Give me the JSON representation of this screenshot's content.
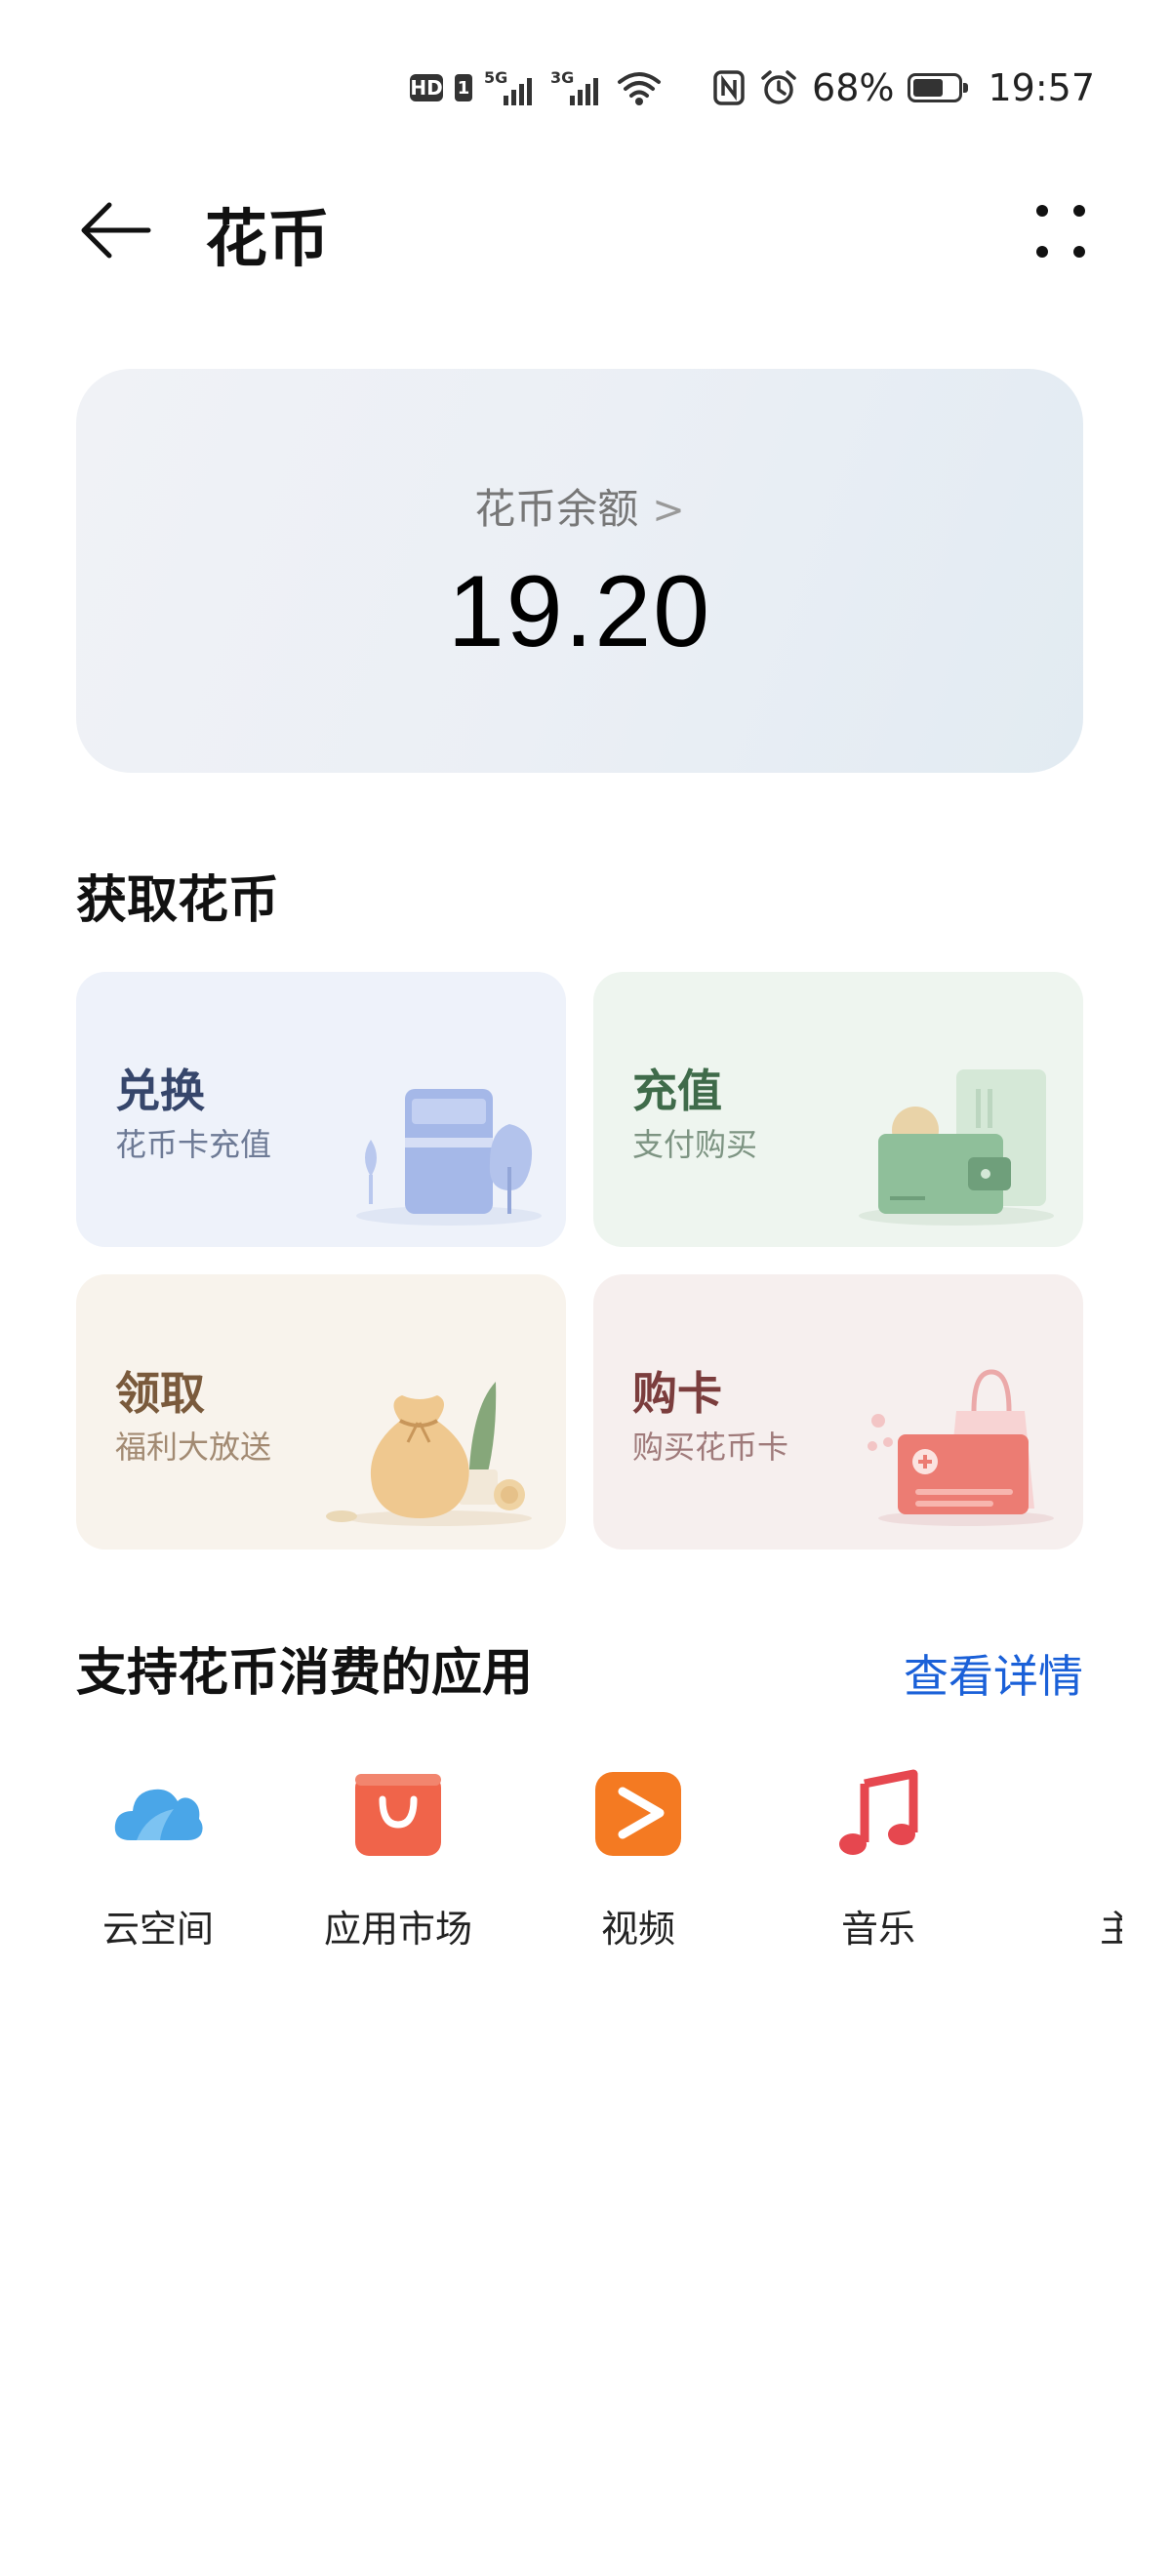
{
  "status_bar": {
    "hd": "HD",
    "sim": "1",
    "sig1_tag": "5G",
    "sig2_tag": "3G",
    "battery_percent": "68%",
    "time": "19:57",
    "battery_level": 0.68
  },
  "header": {
    "title": "花币"
  },
  "balance": {
    "label": "花币余额",
    "value": "19.20"
  },
  "earn_section": {
    "title": "获取花币",
    "tiles": [
      {
        "title": "兑换",
        "subtitle": "花币卡充值"
      },
      {
        "title": "充值",
        "subtitle": "支付购买"
      },
      {
        "title": "领取",
        "subtitle": "福利大放送"
      },
      {
        "title": "购卡",
        "subtitle": "购买花币卡"
      }
    ]
  },
  "apps_section": {
    "title": "支持花币消费的应用",
    "details_link": "查看详情",
    "apps": [
      {
        "label": "云空间",
        "icon": "cloud-icon",
        "color": "#4aa6e8"
      },
      {
        "label": "应用市场",
        "icon": "app-market-icon",
        "color": "#f0644a"
      },
      {
        "label": "视频",
        "icon": "video-icon",
        "color": "#f47a22"
      },
      {
        "label": "音乐",
        "icon": "music-icon",
        "color": "#e6474f"
      },
      {
        "label": "主",
        "icon": "theme-icon",
        "color": "#e8453c"
      }
    ]
  }
}
